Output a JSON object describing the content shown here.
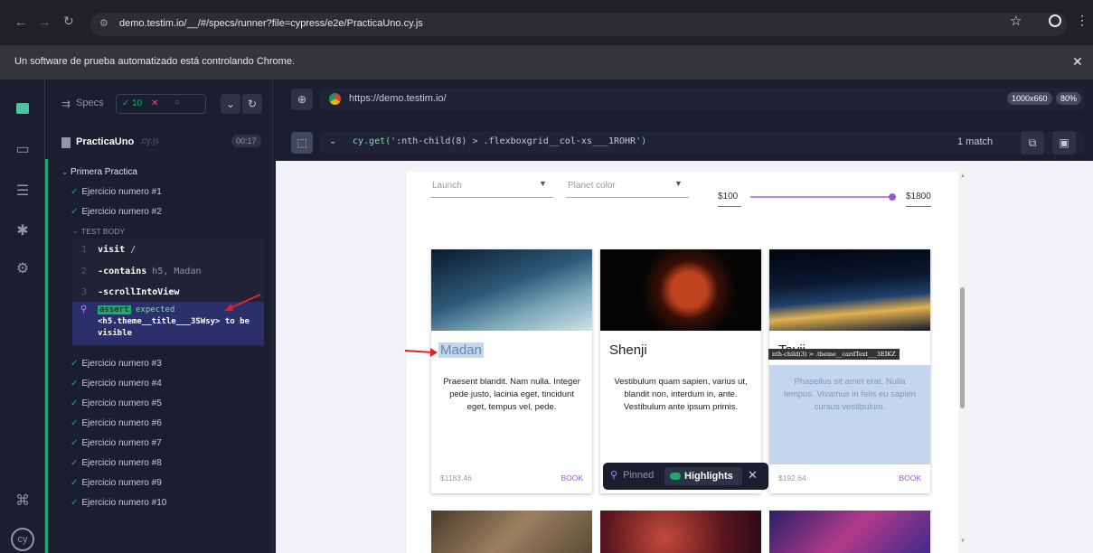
{
  "browser": {
    "url": "demo.testim.io/__/#/specs/runner?file=cypress/e2e/PracticaUno.cy.js",
    "automation_notice": "Un software de prueba automatizado está controlando Chrome."
  },
  "reporter": {
    "specs_label": "Specs",
    "passed_count": "10",
    "failed_mark": "✕",
    "spec_name": "PracticaUno",
    "spec_ext": ".cy.js",
    "duration": "00:17",
    "suite_title": "Primera Practica",
    "tests_before": [
      "Ejercicio numero #1",
      "Ejercicio numero #2"
    ],
    "test_body_label": "TEST BODY",
    "commands": [
      {
        "n": "1",
        "name": "visit",
        "arg": "/"
      },
      {
        "n": "2",
        "name": "-contains",
        "arg": "h5, Madan"
      },
      {
        "n": "3",
        "name": "-scrollIntoView",
        "arg": ""
      }
    ],
    "assert_cmd": {
      "n": "4",
      "name": "assert",
      "text1": "expected",
      "text2": "<h5.theme__title___3SWsy> to be",
      "text3": "visible"
    },
    "tests_after": [
      "Ejercicio numero #3",
      "Ejercicio numero #4",
      "Ejercicio numero #5",
      "Ejercicio numero #6",
      "Ejercicio numero #7",
      "Ejercicio numero #8",
      "Ejercicio numero #9",
      "Ejercicio numero #10"
    ]
  },
  "aut_header": {
    "url": "https://demo.testim.io/",
    "viewport": "1000x660",
    "zoom": "80%",
    "selector_cmd": "cy.get('",
    "selector": ":nth-child(8) > .flexboxgrid__col-xs___1ROHR",
    "selector_end": "')",
    "match_count": "1 match"
  },
  "app": {
    "launch_label": "Launch",
    "planet_label": "Planet color",
    "price_min": "$100",
    "price_max": "$1800",
    "cards": [
      {
        "title": "Madan",
        "text": "Praesent blandit. Nam nulla. Integer pede justo, lacinia eget, tincidunt eget, tempus vel, pede.",
        "price": "$1183.46",
        "book": "BOOK"
      },
      {
        "title": "Shenji",
        "text": "Vestibulum quam sapien, varius ut, blandit non, interdum in, ante. Vestibulum ante ipsum primis.",
        "price": "",
        "book": ""
      },
      {
        "title": "Tayji",
        "text": "Phasellus sit amet erat. Nulla tempus. Vivamus in felis eu sapien cursus vestibulum.",
        "price": "$192.64",
        "book": "BOOK"
      }
    ],
    "tooltip": "nth-child(3) > .theme__cardText___3EIKZ"
  },
  "pinned_bar": {
    "pinned_label": "Pinned",
    "highlights_label": "Highlights"
  },
  "colors": {
    "accent": "#1fa971",
    "highlight": "#c3d6ee",
    "cypress_bg": "#1b1e2e"
  }
}
